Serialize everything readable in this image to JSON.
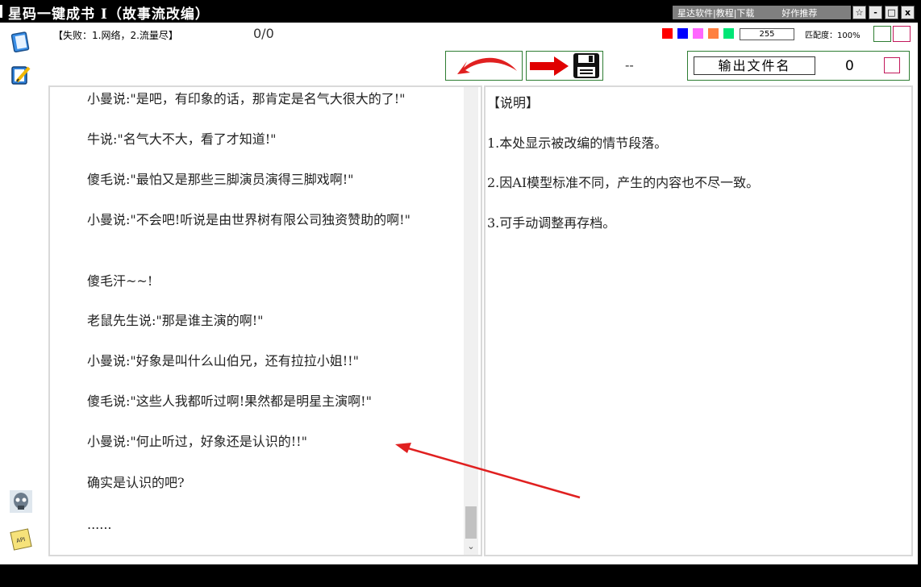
{
  "window": {
    "title": "星码一键成书 I（故事流改编）",
    "links": [
      "星达软件|教程|下载",
      "好作推荐"
    ],
    "controls": [
      "☆",
      "-",
      "□",
      "x"
    ]
  },
  "status": {
    "failure_text": "【失败：1.网络，2.流量尽】",
    "progress": "0/0",
    "swatch_colors": [
      "#ff0000",
      "#0000ff",
      "#ff66ff",
      "#ff8040",
      "#00e676"
    ],
    "number_value": "255",
    "match_text": "匹配度：100%"
  },
  "toolbar": {
    "undo_icon": "curved-arrow-left-icon",
    "save_icon": "floppy-disk-icon",
    "dash": "--",
    "output_label": "输出文件名",
    "output_count": "0"
  },
  "sidebar": {
    "icons": [
      "book-icon",
      "notebook-pencil-icon",
      "skull-avatar-icon",
      "api-note-icon"
    ]
  },
  "story": {
    "lines": [
      "小曼说:\"是吧，有印象的话，那肯定是名气大很大的了!\"",
      "牛说:\"名气大不大，看了才知道!\"",
      "傻毛说:\"最怕又是那些三脚演员演得三脚戏啊!\"",
      "小曼说:\"不会吧!听说是由世界树有限公司独资赞助的啊!\"",
      "傻毛汗~~!",
      "老鼠先生说:\"那是谁主演的啊!\"",
      "小曼说:\"好象是叫什么山伯兄，还有拉拉小姐!!\"",
      "傻毛说:\"这些人我都听过啊!果然都是明星主演啊!\"",
      "小曼说:\"何止听过，好象还是认识的!!\"",
      "确实是认识的吧?",
      "......"
    ]
  },
  "notes": {
    "heading": "【说明】",
    "items": [
      "1.本处显示被改编的情节段落。",
      "2.因AI模型标准不同，产生的内容也不尽一致。",
      "3.可手动调整再存档。"
    ]
  },
  "colors": {
    "frame_border": "#2e7d32",
    "arrow_red": "#e02020",
    "panel_border": "#d9d9d9"
  }
}
